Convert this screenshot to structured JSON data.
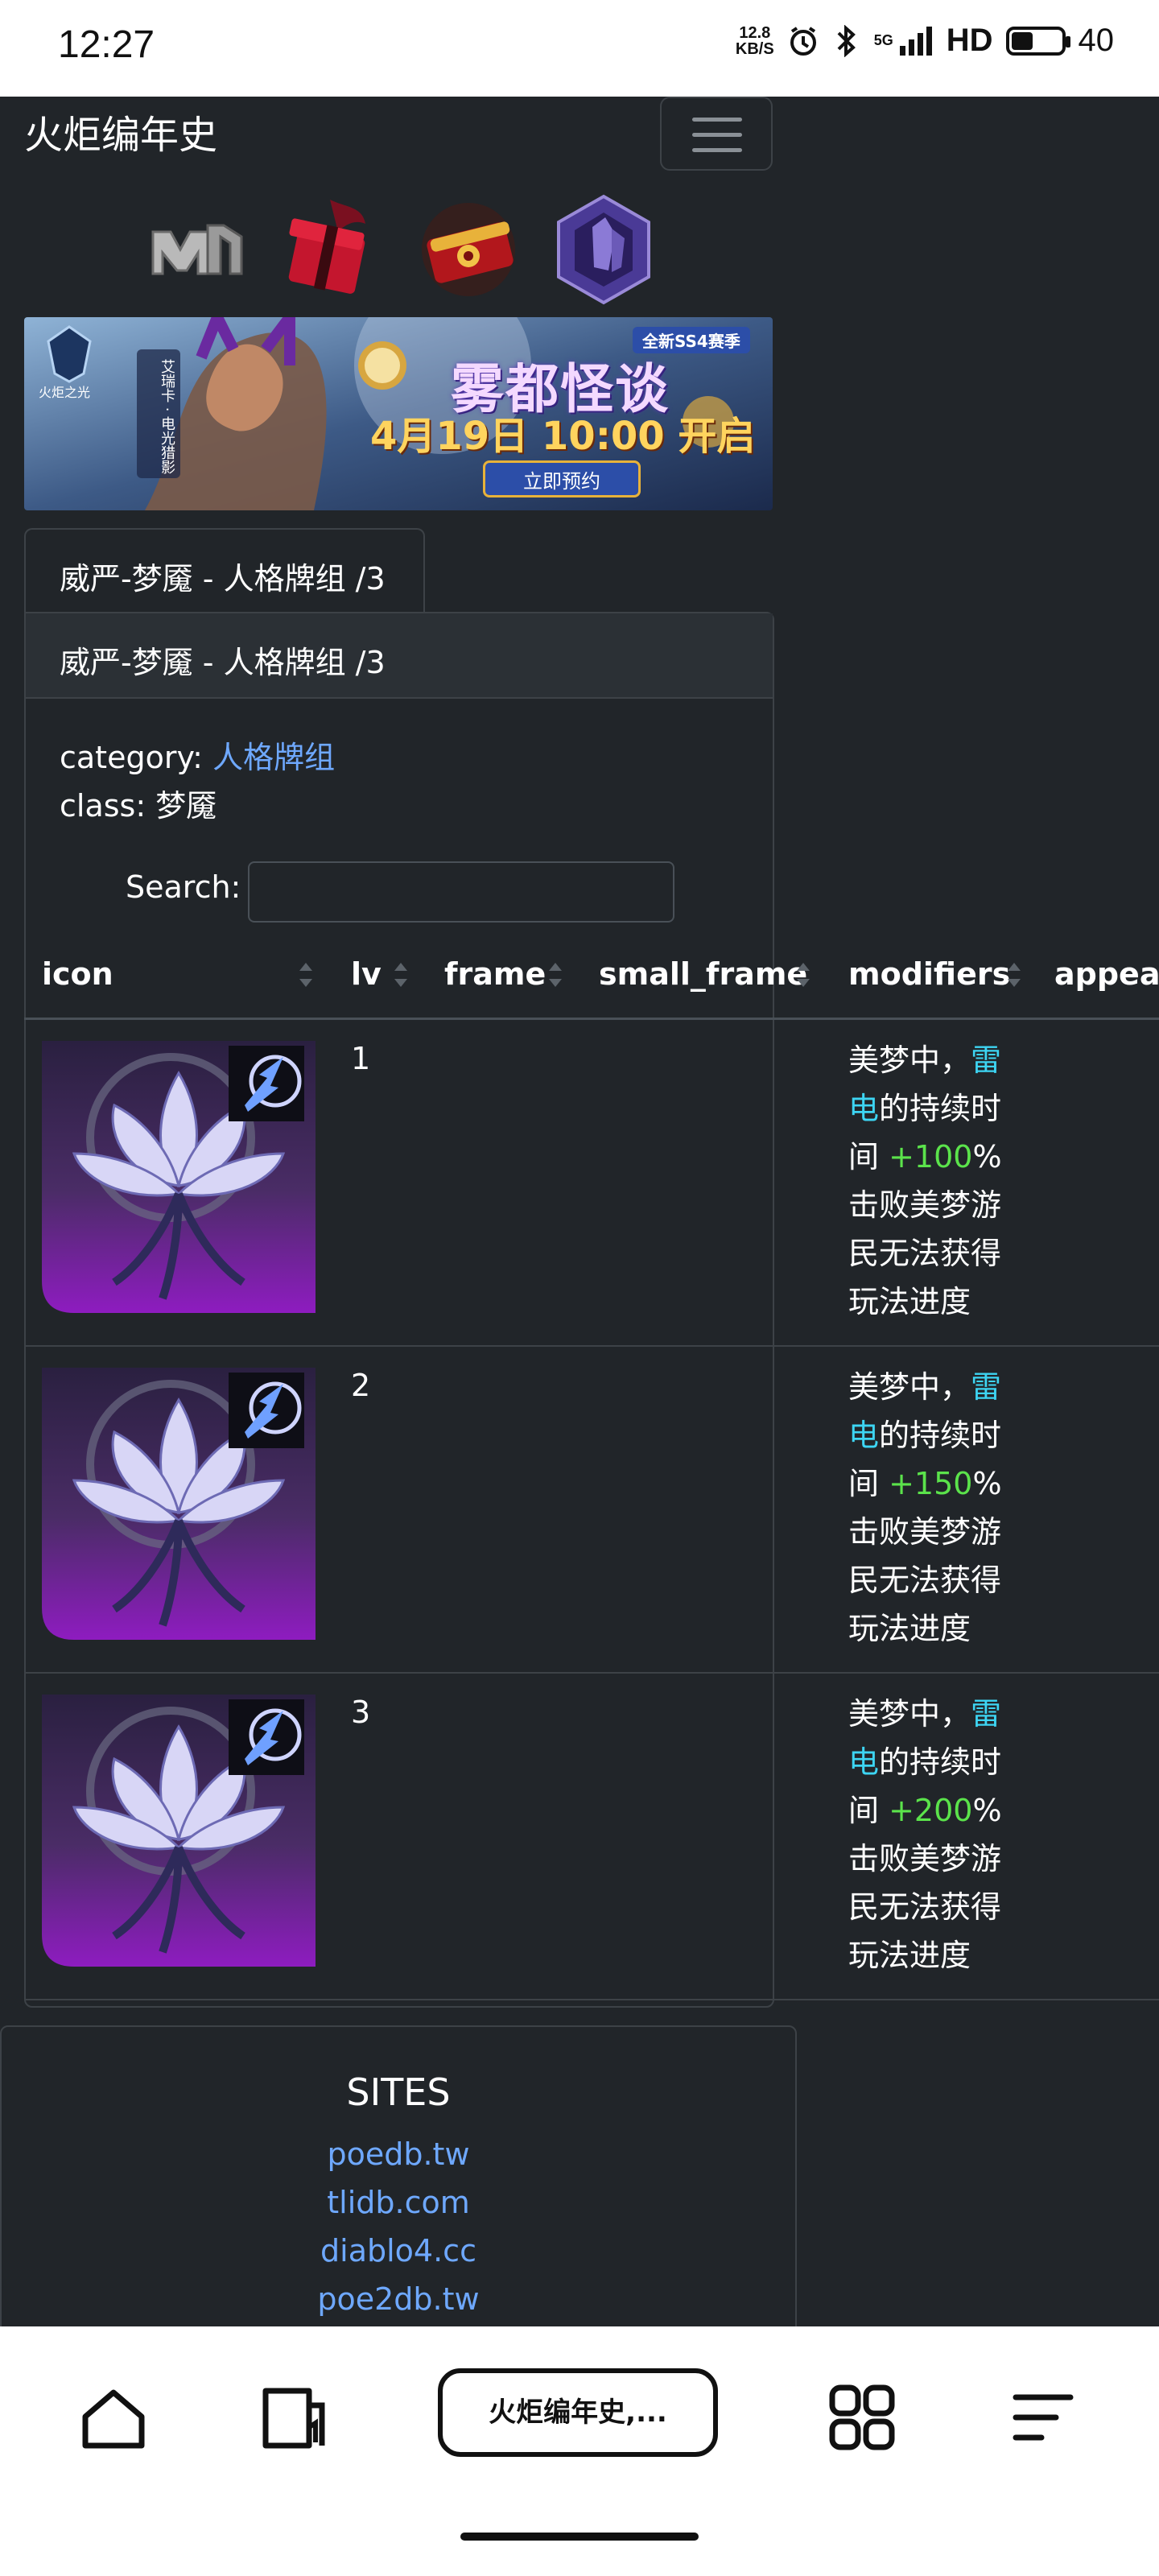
{
  "status_bar": {
    "time": "12:27",
    "net_speed_top": "12.8",
    "net_speed_bottom": "KB/S",
    "network": "5G",
    "hd": "HD",
    "battery": "40"
  },
  "header": {
    "site_title": "火炬编年史"
  },
  "game_icons": [
    "poe-logo-icon",
    "gift-box-icon",
    "treasure-chest-icon",
    "purple-crystal-icon"
  ],
  "banner": {
    "brand": "火炬之光",
    "side_text": "艾瑞卡 · 电光猎影",
    "season_tag": "全新SS4赛季",
    "headline": "雾都怪谈",
    "date_text": "4月19日 10:00 开启",
    "cta": "立即预约"
  },
  "tab": {
    "label": "威严-梦魇 - 人格牌组 /3"
  },
  "card": {
    "header": "威严-梦魇 - 人格牌组 /3",
    "category_label": "category: ",
    "category_value": "人格牌组",
    "class_label": "class: ",
    "class_value": "梦魇",
    "search_label": "Search:",
    "search_value": ""
  },
  "table": {
    "columns": [
      "icon",
      "lv",
      "frame",
      "small_frame",
      "modifiers",
      "appear_"
    ],
    "rows": [
      {
        "lv": "1",
        "mod_a": "美梦中，",
        "mod_kw1": "雷",
        "mod_kw2": "电",
        "mod_b": "的持续时",
        "mod_c": "间 ",
        "mod_val": "+100",
        "mod_pct": "%",
        "mod_d": "击败美梦游",
        "mod_e": "民无法获得",
        "mod_f": "玩法进度"
      },
      {
        "lv": "2",
        "mod_a": "美梦中，",
        "mod_kw1": "雷",
        "mod_kw2": "电",
        "mod_b": "的持续时",
        "mod_c": "间 ",
        "mod_val": "+150",
        "mod_pct": "%",
        "mod_d": "击败美梦游",
        "mod_e": "民无法获得",
        "mod_f": "玩法进度"
      },
      {
        "lv": "3",
        "mod_a": "美梦中，",
        "mod_kw1": "雷",
        "mod_kw2": "电",
        "mod_b": "的持续时",
        "mod_c": "间 ",
        "mod_val": "+200",
        "mod_pct": "%",
        "mod_d": "击败美梦游",
        "mod_e": "民无法获得",
        "mod_f": "玩法进度"
      }
    ]
  },
  "footer": {
    "title": "SITES",
    "links": [
      "poedb.tw",
      "tlidb.com",
      "diablo4.cc",
      "poe2db.tw"
    ]
  },
  "browser_bar": {
    "tab_title": "火炬编年史,..."
  },
  "colors": {
    "background": "#212529",
    "link": "#6ea8fe",
    "keyword": "#3dd5f3",
    "value": "#5be34b",
    "icon_gradient_bottom": "#8e1cc0"
  }
}
